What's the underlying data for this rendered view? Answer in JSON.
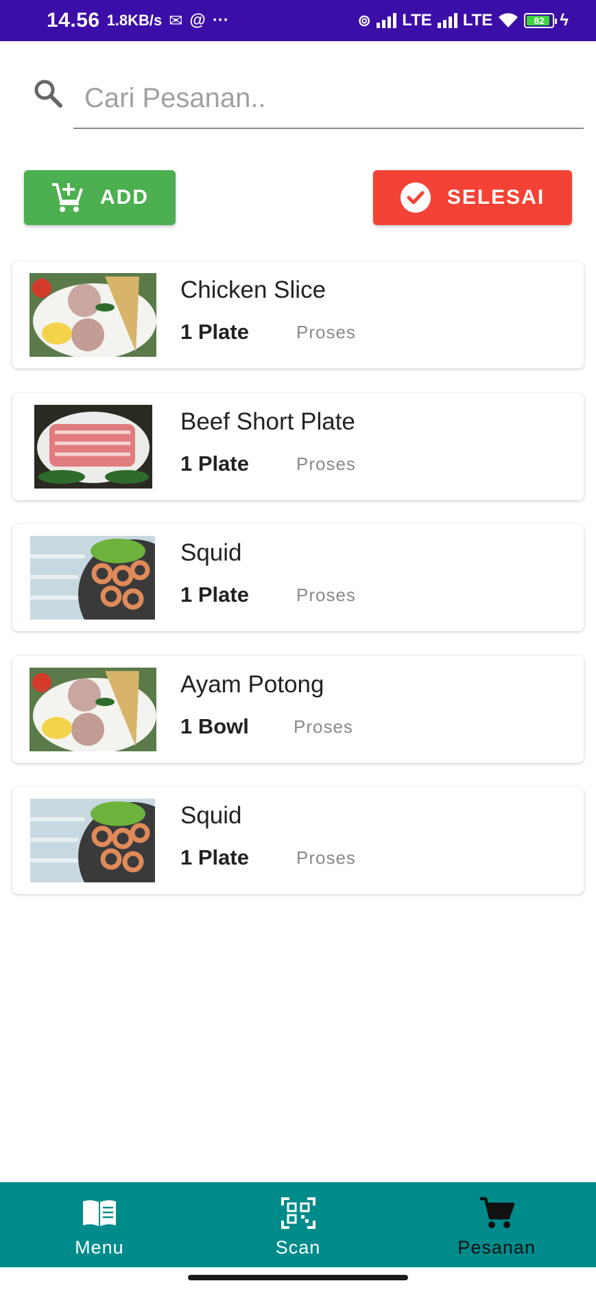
{
  "status_bar": {
    "time": "14.56",
    "network_speed": "1.8KB/s",
    "carrier1": "LTE",
    "carrier2": "LTE",
    "battery": "82"
  },
  "search": {
    "placeholder": "Cari Pesanan..",
    "icon": "search-icon"
  },
  "actions": {
    "add_label": "ADD",
    "add_icon": "cart-plus-icon",
    "done_label": "SELESAI",
    "done_icon": "check-circle-icon",
    "add_color": "#4caf50",
    "done_color": "#f44336"
  },
  "orders": [
    {
      "name": "Chicken Slice",
      "qty": "1 Plate",
      "status": "Proses"
    },
    {
      "name": "Beef Short Plate",
      "qty": "1 Plate",
      "status": "Proses"
    },
    {
      "name": "Squid",
      "qty": "1 Plate",
      "status": "Proses"
    },
    {
      "name": "Ayam Potong",
      "qty": "1 Bowl",
      "status": "Proses"
    },
    {
      "name": "Squid",
      "qty": "1 Plate",
      "status": "Proses"
    }
  ],
  "bottom_nav": {
    "items": [
      {
        "label": "Menu",
        "icon": "book-icon"
      },
      {
        "label": "Scan",
        "icon": "qr-scan-icon"
      },
      {
        "label": "Pesanan",
        "icon": "cart-icon"
      }
    ],
    "active": "Pesanan",
    "color": "#008b8b"
  },
  "theme": {
    "status_bar_color": "#3b0ea8"
  }
}
